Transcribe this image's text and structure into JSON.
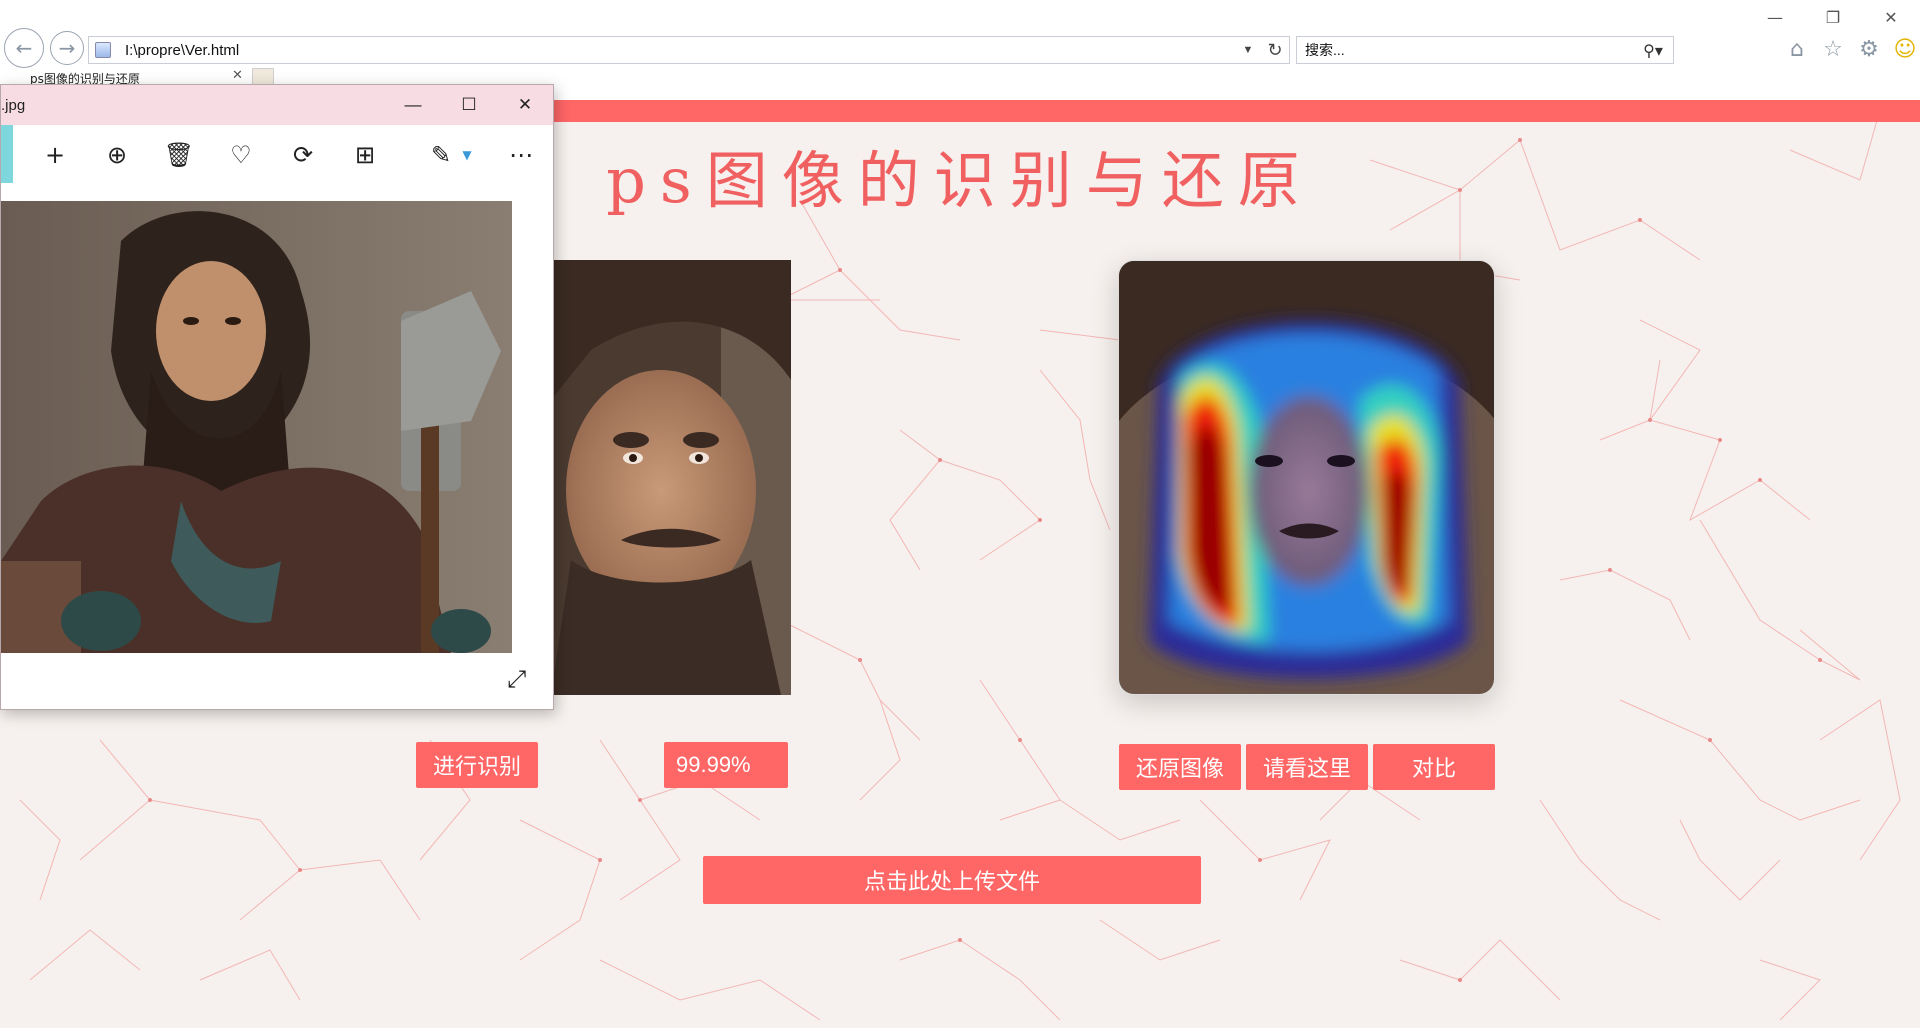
{
  "browser": {
    "address": "I:\\propre\\Ver.html",
    "search_placeholder": "搜索...",
    "tab_title": "ps图像的识别与还原",
    "window_controls": {
      "minimize": "—",
      "restore": "❐",
      "close": "✕"
    },
    "icons": [
      "back-icon",
      "forward-icon",
      "refresh-icon",
      "search-icon",
      "home-icon",
      "star-icon",
      "gear-icon",
      "smiley-icon"
    ]
  },
  "page": {
    "title": "ps图像的识别与还原",
    "buttons": {
      "recognize": "进行识别",
      "score": "99.99%",
      "restore": "还原图像",
      "look_here": "请看这里",
      "compare": "对比",
      "upload": "点击此处上传文件"
    },
    "colors": {
      "accent": "#ff6666",
      "background": "#f6f1ee",
      "title": "#f06060"
    }
  },
  "viewer": {
    "filename": ".jpg",
    "toolbar": [
      "add-icon",
      "zoom-in-icon",
      "delete-icon",
      "favorite-icon",
      "rotate-icon",
      "crop-icon",
      "edit-icon",
      "more-icon"
    ]
  }
}
